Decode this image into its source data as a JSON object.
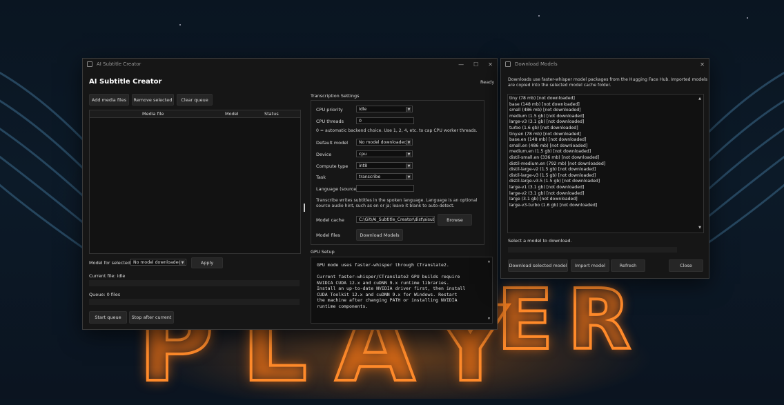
{
  "main_window": {
    "title": "AI Subtitle Creator",
    "controls": {
      "minimize": "—",
      "maximize": "☐",
      "close": "✕"
    },
    "heading": "AI Subtitle Creator",
    "status": "Ready",
    "toolbar": {
      "add": "Add media files",
      "remove": "Remove selected",
      "clear": "Clear queue"
    },
    "table_headers": {
      "media": "Media file",
      "model": "Model",
      "status": "Status"
    },
    "model_for_selected_label": "Model for selected:",
    "model_for_selected_value": "No model downloaded",
    "apply": "Apply",
    "current_file": "Current file: idle",
    "queue": "Queue: 0 files",
    "start": "Start queue",
    "stop": "Stop after current",
    "settings": {
      "section": "Transcription Settings",
      "cpu_priority_label": "CPU priority",
      "cpu_priority_value": "Idle",
      "cpu_threads_label": "CPU threads",
      "cpu_threads_value": "0",
      "threads_hint": "0 = automatic backend choice. Use 1, 2, 4, etc. to cap CPU worker threads.",
      "default_model_label": "Default model",
      "default_model_value": "No model downloaded",
      "device_label": "Device",
      "device_value": "cpu",
      "compute_label": "Compute type",
      "compute_value": "int8",
      "task_label": "Task",
      "task_value": "transcribe",
      "language_label": "Language (source)",
      "language_value": "",
      "task_hint_1": "Transcribe writes subtitles in the spoken language. Language is an optional",
      "task_hint_2": "source audio hint, such as en or ja; leave it blank to auto-detect.",
      "cache_label": "Model cache",
      "cache_value": "C:\\Git\\AI_Subtitle_Creator\\dist\\aisub-g",
      "browse": "Browse",
      "files_label": "Model files",
      "download_btn": "Download Models"
    },
    "gpu": {
      "section": "GPU Setup",
      "line1": "GPU mode uses faster-whisper through CTranslate2.",
      "p2": [
        "Current faster-whisper/CTranslate2 GPU builds require",
        "NVIDIA CUDA 12.x and cuDNN 9.x runtime libraries.",
        "Install an up-to-date NVIDIA driver first, then install",
        "CUDA Toolkit 12.x and cuDNN 9.x for Windows. Restart",
        "the machine after changing PATH or installing NVIDIA",
        "runtime components."
      ]
    }
  },
  "download_window": {
    "title": "Download Models",
    "close": "✕",
    "desc_1": "Downloads use faster-whisper model packages from the Hugging Face Hub. Imported models",
    "desc_2": "are copied into the selected model cache folder.",
    "models": [
      "tiny (78 mb) [not downloaded]",
      "base (148 mb) [not downloaded]",
      "small (486 mb) [not downloaded]",
      "medium (1.5 gb) [not downloaded]",
      "large-v3 (3.1 gb) [not downloaded]",
      "turbo (1.6 gb) [not downloaded]",
      "tiny.en (78 mb) [not downloaded]",
      "base.en (148 mb) [not downloaded]",
      "small.en (486 mb) [not downloaded]",
      "medium.en (1.5 gb) [not downloaded]",
      "distil-small.en (336 mb) [not downloaded]",
      "distil-medium.en (792 mb) [not downloaded]",
      "distil-large-v2 (1.5 gb) [not downloaded]",
      "distil-large-v3 (1.5 gb) [not downloaded]",
      "distil-large-v3.5 (1.5 gb) [not downloaded]",
      "large-v1 (3.1 gb) [not downloaded]",
      "large-v2 (3.1 gb) [not downloaded]",
      "large (3.1 gb) [not downloaded]",
      "large-v3-turbo (1.6 gb) [not downloaded]"
    ],
    "hint": "Select a model to download.",
    "buttons": {
      "download": "Download selected model",
      "import": "Import model",
      "refresh": "Refresh",
      "close": "Close"
    }
  }
}
